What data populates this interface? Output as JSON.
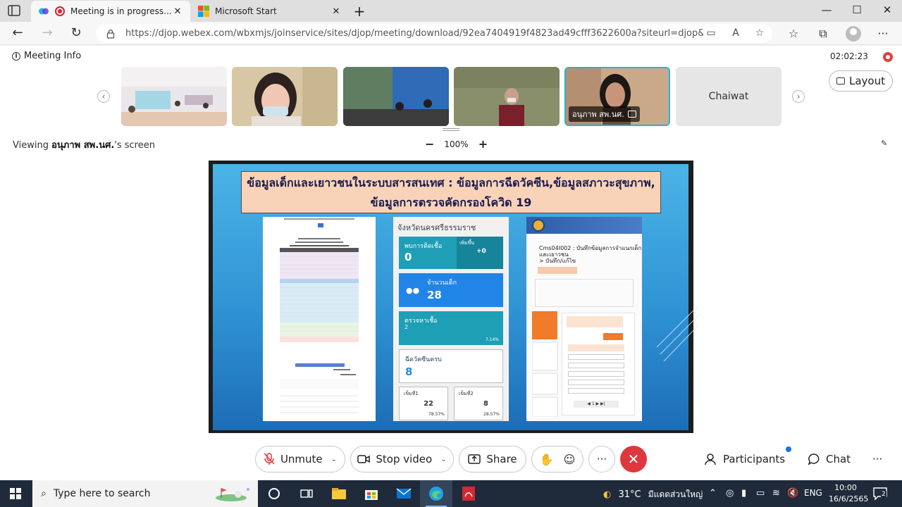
{
  "browser": {
    "tabs": [
      {
        "title": "Meeting is in progress...",
        "active": true
      },
      {
        "title": "Microsoft Start",
        "active": false
      }
    ],
    "url": "https://djop.webex.com/wbxmjs/joinservice/sites/djop/meeting/download/92ea7404919f4823ad49cfff3622600a?siteurl=djop&MTID=m9e...",
    "window_controls": {
      "minimize": "—",
      "maximize": "☐",
      "close": "✕"
    }
  },
  "meeting": {
    "info_label": "Meeting Info",
    "timer": "02:02:23",
    "layout_label": "Layout",
    "participants_strip": [
      {
        "name": "",
        "kind": "room"
      },
      {
        "name": "",
        "kind": "person-mask"
      },
      {
        "name": "",
        "kind": "office"
      },
      {
        "name": "",
        "kind": "person-desk"
      },
      {
        "name": "อนุภาพ สพ.นศ.",
        "kind": "presenter",
        "selected": true
      },
      {
        "name": "Chaiwat",
        "kind": "no-video"
      }
    ],
    "viewing_prefix": "Viewing ",
    "viewing_name": "อนุภาพ สพ.นศ.",
    "viewing_suffix": "'s screen",
    "zoom_minus": "−",
    "zoom_level": "100%",
    "zoom_plus": "+"
  },
  "shared_slide": {
    "title_line1": "ข้อมูลเด็กและเยาวชนในระบบสารสนเทศ : ข้อมูลการฉีดวัคซีน,ข้อมูลสภาวะสุขภาพ,",
    "title_line2": "ข้อมูลการตรวจคัดกรองโควิด 19",
    "dashboard": {
      "province": "จังหวัดนครศรีธรรมราช",
      "infected_label": "พบการติดเชื้อ",
      "infected_value": "0",
      "increase_label": "เพิ่มขึ้น",
      "increase_value": "+0",
      "children_label": "จำนวนเด็ก",
      "children_value": "28",
      "screening_label": "ตรวจหาเชื้อ",
      "screening_value": "2",
      "screening_pct": "7.14%",
      "vaccinated_label": "ฉีดวัคซีนครบ",
      "vaccinated_value": "8",
      "dose1_label": "เข็มที่1",
      "dose1_value": "22",
      "dose1_pct": "78.57%",
      "dose2_label": "เข็มที่2",
      "dose2_value": "8",
      "dose2_pct": "28.57%"
    },
    "form": {
      "code_title": "Cms04I002 : บันทึกข้อมูลการจำแนกเด็กและเยาวชน",
      "subtitle": "> บันทึก/แก้ไข"
    }
  },
  "controls": {
    "unmute": "Unmute",
    "stop_video": "Stop video",
    "share": "Share",
    "more": "···",
    "end": "✕",
    "participants": "Participants",
    "chat": "Chat",
    "overflow": "···"
  },
  "taskbar": {
    "search_placeholder": "Type here to search",
    "weather_temp": "31°C",
    "weather_text": "มีแดดส่วนใหญ่",
    "language": "ENG",
    "time": "10:00",
    "date": "16/6/2565",
    "notification_count": "2"
  },
  "colors": {
    "end_red": "#e0363d",
    "accent_blue": "#1a73e8",
    "selected_thumb": "#2bb0d6",
    "taskbar": "#1f2b3b"
  }
}
